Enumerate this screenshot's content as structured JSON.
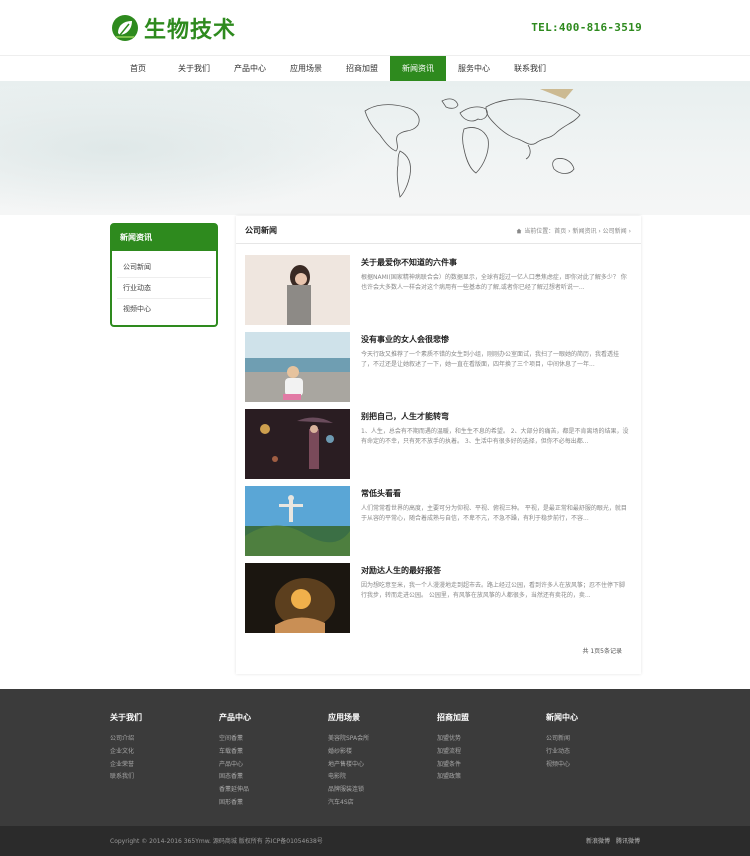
{
  "header": {
    "logo_text": "生物技术",
    "tel": "TEL:400-816-3519"
  },
  "nav": {
    "items": [
      {
        "label": "首页",
        "active": false
      },
      {
        "label": "关于我们",
        "active": false
      },
      {
        "label": "产品中心",
        "active": false
      },
      {
        "label": "应用场景",
        "active": false
      },
      {
        "label": "招商加盟",
        "active": false
      },
      {
        "label": "新闻资讯",
        "active": true
      },
      {
        "label": "服务中心",
        "active": false
      },
      {
        "label": "联系我们",
        "active": false
      }
    ]
  },
  "sidebar": {
    "title": "新闻资讯",
    "items": [
      {
        "label": "公司新闻"
      },
      {
        "label": "行业动态"
      },
      {
        "label": "视频中心"
      }
    ]
  },
  "content": {
    "title": "公司新闻",
    "breadcrumb": "当前位置：首页 › 新闻资讯 › 公司新闻 ›",
    "posts": [
      {
        "title": "关于最爱你不知道的六件事",
        "desc": "根据NAMI(国家精神病联合会）的数据显示，全球有超过一亿人口患焦虑症，即你对此了解多少？ 你也许会大多数人一样会对这个病用有一些基本的了解,或者你已经了解过想者听说一..."
      },
      {
        "title": "没有事业的女人会很悲惨",
        "desc": "今天行政又推荐了一个素质不错的女生到小组，刚刚办公室面试，我扫了一眼她的简历，我看透挂了，不过还是让她叙述了一下，她一直在看版面，四年换了三个项目，中间休息了一年..."
      },
      {
        "title": "别把自己，人生才能转弯",
        "desc": "1、人生，总会有不期而遇的温暖，和生生不息的希望。 2、大部分的痛苦，都是不肯离场的结果，没有命定的不幸，只有死不放手的执着。 3、生活中有很多好的选择，但你不必每出都..."
      },
      {
        "title": "常低头看看",
        "desc": "人们常常看世界的高度，主要可分为仰视、平视、俯视三种。 平视，是最正常和最舒服的眼光，就目于从容的平常心，随合着成熟与自信，不卑不亢，不急不躁，有利于稳步前行，不容..."
      },
      {
        "title": "对励达人生的最好报答",
        "desc": "因为想吃意至米，我一个人漫漫地走到超市去。路上经过公园，看到许多人在放风筝；忍不住停下脚行我步，转而走进公园。 公园里，有风筝在放风筝的人都很多，当然还有卖花的，卖..."
      }
    ],
    "pager": "共 1页5条记录"
  },
  "footer": {
    "columns": [
      {
        "title": "关于我们",
        "items": [
          "公司介绍",
          "企业文化",
          "企业荣誉",
          "联系我们"
        ]
      },
      {
        "title": "产品中心",
        "items": [
          "空间香薰",
          "车载香薰",
          "产品中心",
          "固态香薰",
          "香薰延伸品",
          "固形香薰"
        ]
      },
      {
        "title": "应用场景",
        "items": [
          "美容院SPA会所",
          "婚纱影楼",
          "地产售楼中心",
          "电影院",
          "品牌服装连锁",
          "汽车4S店"
        ]
      },
      {
        "title": "招商加盟",
        "items": [
          "加盟优势",
          "加盟流程",
          "加盟条件",
          "加盟政策"
        ]
      },
      {
        "title": "新闻中心",
        "items": [
          "公司新闻",
          "行业动态",
          "视频中心"
        ]
      }
    ],
    "copyright": "Copyright © 2014-2016 365Ymw. 源码商城 版权所有   苏ICP备01054638号",
    "links": [
      "新浪微博",
      "腾讯微博"
    ]
  },
  "colors": {
    "brand_green": "#2e8a1e",
    "footer_bg": "#3b3b3b",
    "copyright_bg": "#2b2b2b"
  }
}
